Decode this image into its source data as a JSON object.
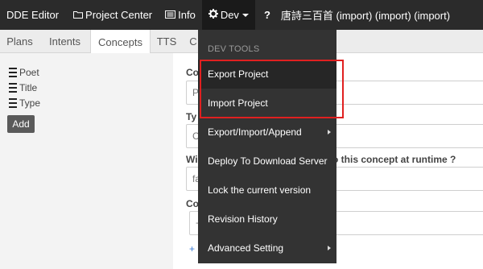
{
  "navbar": {
    "brand": "DDE Editor",
    "project_center": "Project Center",
    "info": "Info",
    "dev": "Dev",
    "help": "?",
    "project_title": "唐詩三百首 (import) (import) (import)"
  },
  "tabs": [
    "Plans",
    "Intents",
    "Concepts",
    "TTS",
    "C"
  ],
  "active_tab": "Concepts",
  "sidebar": {
    "items": [
      "Poet",
      "Title",
      "Type"
    ],
    "add_label": "Add"
  },
  "form": {
    "label_1": "Co",
    "input_1": "P",
    "label_2": "Ty",
    "input_2": "C",
    "label_3_left": "Wi",
    "label_3_right": "o this concept at runtime ?",
    "input_3": "fa",
    "label_4": "Co",
    "input_4": "+",
    "plus_link": "+"
  },
  "dev_menu": {
    "header": "DEV TOOLS",
    "items": [
      {
        "label": "Export Project",
        "submenu": false
      },
      {
        "label": "Import Project",
        "submenu": false
      },
      {
        "label": "Export/Import/Append",
        "submenu": true
      },
      {
        "label": "Deploy To Download Server",
        "submenu": false
      },
      {
        "label": "Lock the current version",
        "submenu": false
      },
      {
        "label": "Revision History",
        "submenu": false
      },
      {
        "label": "Advanced Setting",
        "submenu": true
      }
    ]
  },
  "colors": {
    "navbar_bg": "#2b2b2b",
    "menu_bg": "#333333",
    "highlight": "#e02020"
  }
}
